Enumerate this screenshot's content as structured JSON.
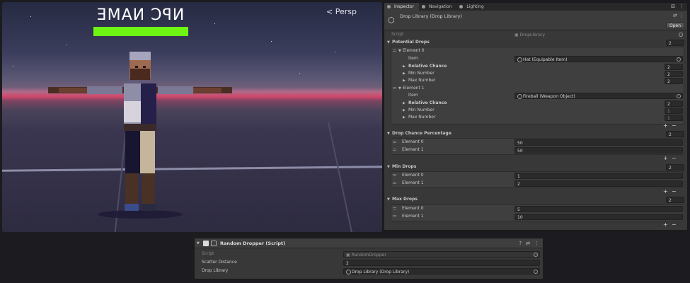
{
  "scene": {
    "npc_name": "NPC NAME",
    "view_mode": "Persp",
    "health_fraction": 1.0,
    "health_color": "#6ef514"
  },
  "inspector": {
    "tabs": [
      {
        "label": "Inspector",
        "icon": "info-icon",
        "active": true
      },
      {
        "label": "Navigation",
        "icon": "navigation-icon",
        "active": false
      },
      {
        "label": "Lighting",
        "icon": "lightbulb-icon",
        "active": false
      }
    ],
    "asset_title": "Drop Library (Drop Library)",
    "open_label": "Open",
    "script_label": "Script",
    "script_value": "DropLibrary",
    "potential_drops": {
      "label": "Potential Drops",
      "count": "2",
      "elements": [
        {
          "label": "Element 0",
          "item_label": "Item",
          "item_value": "Hat (Equipable Item)",
          "relative_chance_label": "Relative Chance",
          "relative_chance": "2",
          "min_number_label": "Min Number",
          "min_number": "2",
          "max_number_label": "Max Number",
          "max_number": "2"
        },
        {
          "label": "Element 1",
          "item_label": "Item",
          "item_value": "Fireball (Weapon Object)",
          "relative_chance_label": "Relative Chance",
          "relative_chance": "2",
          "min_number_label": "Min Number",
          "min_number": "1",
          "max_number_label": "Max Number",
          "max_number": "1"
        }
      ]
    },
    "drop_chance_percentage": {
      "label": "Drop Chance Percentage",
      "count": "2",
      "elements": [
        {
          "label": "Element 0",
          "value": "50"
        },
        {
          "label": "Element 1",
          "value": "50"
        }
      ]
    },
    "min_drops": {
      "label": "Min Drops",
      "count": "2",
      "elements": [
        {
          "label": "Element 0",
          "value": "1"
        },
        {
          "label": "Element 1",
          "value": "2"
        }
      ]
    },
    "max_drops": {
      "label": "Max Drops",
      "count": "2",
      "elements": [
        {
          "label": "Element 0",
          "value": "5"
        },
        {
          "label": "Element 1",
          "value": "10"
        }
      ]
    },
    "plus": "+",
    "minus": "−"
  },
  "dropper": {
    "title": "Random Dropper (Script)",
    "script_label": "Script",
    "script_value": "RandomDropper",
    "scatter_label": "Scatter Distance",
    "scatter_value": "2",
    "library_label": "Drop Library",
    "library_value": "Drop Library (Drop Library)"
  }
}
